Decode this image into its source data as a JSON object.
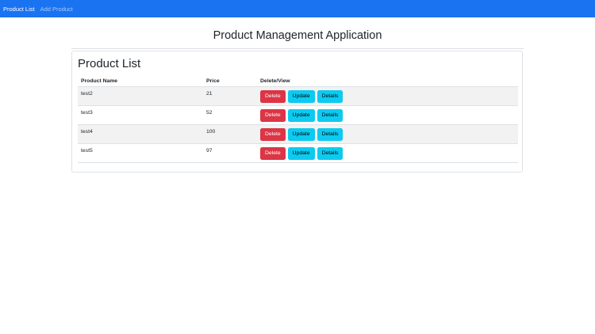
{
  "nav": {
    "items": [
      {
        "label": "Product List",
        "active": true
      },
      {
        "label": "Add Product",
        "active": false
      }
    ],
    "color": "#1a73f0"
  },
  "app_title": "Product Management Application",
  "card": {
    "title": "Product List",
    "headers": {
      "name": "Product Name",
      "price": "Price",
      "actions": "Delete/View"
    },
    "rows": [
      {
        "name": "test2",
        "price": "21"
      },
      {
        "name": "test3",
        "price": "52"
      },
      {
        "name": "test4",
        "price": "100"
      },
      {
        "name": "test5",
        "price": "97"
      }
    ],
    "buttons": {
      "delete": "Delete",
      "update": "Update",
      "details": "Details"
    }
  },
  "colors": {
    "danger": "#dc3545",
    "info": "#0dcaf0"
  }
}
